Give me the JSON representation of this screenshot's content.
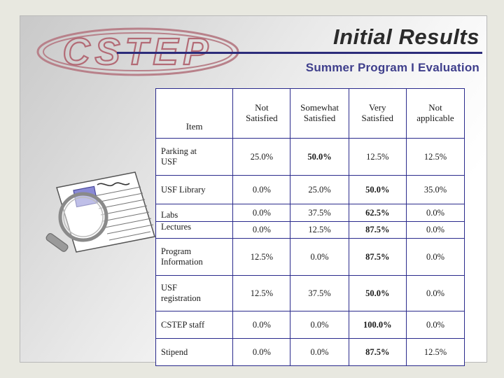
{
  "slide": {
    "title": "Initial Results",
    "subtitle": "Summer Program I Evaluation",
    "logo_text": "CSTEP",
    "accent_color": "#2c2c7a",
    "subtitle_color": "#3f3f8c",
    "logo_color": "#b36b76"
  },
  "table": {
    "columns": [
      "Item",
      "Not Satisfied",
      "Somewhat Satisfied",
      "Very Satisfied",
      "Not applicable"
    ],
    "column_lines": [
      [
        "Item"
      ],
      [
        "Not",
        "Satisfied"
      ],
      [
        "Somewhat",
        "Satisfied"
      ],
      [
        "Very",
        "Satisfied"
      ],
      [
        "Not",
        "applicable"
      ]
    ],
    "rows": [
      {
        "label_lines": [
          "Parking at",
          "USF"
        ],
        "values": [
          "25.0%",
          "50.0%",
          "12.5%",
          "12.5%"
        ],
        "bold": [
          false,
          true,
          false,
          false
        ]
      },
      {
        "label_lines": [
          "USF Library"
        ],
        "values": [
          "0.0%",
          "25.0%",
          "50.0%",
          "35.0%"
        ],
        "bold": [
          false,
          false,
          true,
          false
        ]
      },
      {
        "label_lines": [
          "Labs"
        ],
        "values": [
          "0.0%",
          "37.5%",
          "62.5%",
          "0.0%"
        ],
        "bold": [
          false,
          false,
          true,
          false
        ]
      },
      {
        "label_lines": [
          "Lectures"
        ],
        "values": [
          "0.0%",
          "12.5%",
          "87.5%",
          "0.0%"
        ],
        "bold": [
          false,
          false,
          true,
          false
        ]
      },
      {
        "label_lines": [
          "Program",
          "Information"
        ],
        "values": [
          "12.5%",
          "0.0%",
          "87.5%",
          "0.0%"
        ],
        "bold": [
          false,
          false,
          true,
          false
        ]
      },
      {
        "label_lines": [
          "USF",
          "registration"
        ],
        "values": [
          "12.5%",
          "37.5%",
          "50.0%",
          "0.0%"
        ],
        "bold": [
          false,
          false,
          true,
          false
        ]
      },
      {
        "label_lines": [
          "CSTEP staff"
        ],
        "values": [
          "0.0%",
          "0.0%",
          "100.0%",
          "0.0%"
        ],
        "bold": [
          false,
          false,
          true,
          false
        ]
      },
      {
        "label_lines": [
          "Stipend"
        ],
        "values": [
          "0.0%",
          "0.0%",
          "87.5%",
          "12.5%"
        ],
        "bold": [
          false,
          false,
          true,
          false
        ]
      }
    ]
  }
}
